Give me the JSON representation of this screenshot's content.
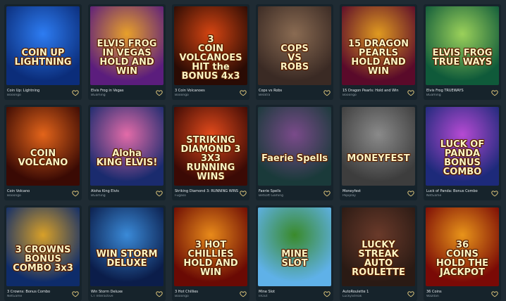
{
  "colors": {
    "background": "#1f2b33",
    "card": "#16232b",
    "heart": "#d9c27a"
  },
  "games": [
    {
      "title": "Coin Up: Lightning",
      "provider": "Booongo",
      "logo": "COIN UP\nLIGHTNING",
      "colors": [
        "#0b2d7a",
        "#2d7cf2"
      ],
      "icon": "heart-icon"
    },
    {
      "title": "Elvis Frog in Vegas",
      "provider": "BGaming",
      "logo": "ELVIS FROG\nIN VEGAS\nHOLD AND WIN",
      "colors": [
        "#5b1d7d",
        "#e8a02a"
      ],
      "icon": "heart-icon"
    },
    {
      "title": "3 Coin Volcanoes",
      "provider": "Booongo",
      "logo": "3\nCOIN\nVOLCANOES\nHIT the BONUS 4x3",
      "colors": [
        "#2a0b04",
        "#d64512"
      ],
      "icon": "heart-icon"
    },
    {
      "title": "Cops vs Robs",
      "provider": "Belatra",
      "logo": "COPS\nVS\nROBS",
      "colors": [
        "#3a2a24",
        "#8a6b52"
      ],
      "icon": "heart-icon"
    },
    {
      "title": "15 Dragon Pearls: Hold and Win",
      "provider": "Booongo",
      "logo": "15 DRAGON\nPEARLS\nHOLD AND WIN",
      "colors": [
        "#5a0a2a",
        "#e09a20"
      ],
      "icon": "heart-icon"
    },
    {
      "title": "Elvis Frog TRUEWAYS",
      "provider": "BGaming",
      "logo": "ELVIS FROG\nTRUE WAYS",
      "colors": [
        "#0f5a3a",
        "#9bd15a"
      ],
      "icon": "heart-icon"
    },
    {
      "title": "Coin Volcano",
      "provider": "Booongo",
      "logo": "COIN\nVOLCANO",
      "colors": [
        "#3a0a04",
        "#e3641a"
      ],
      "icon": "heart-icon"
    },
    {
      "title": "Aloha King Elvis",
      "provider": "BGaming",
      "logo": "Aloha\nKING ELVIS!",
      "colors": [
        "#1a2b6e",
        "#e36ba8"
      ],
      "icon": "heart-icon"
    },
    {
      "title": "Striking Diamond 3: RUNNING WINS",
      "provider": "Fugaso",
      "logo": "STRIKING\nDIAMOND 3\n3X3 RUNNING WINS",
      "colors": [
        "#3b0a05",
        "#e34a1b"
      ],
      "icon": "heart-icon"
    },
    {
      "title": "Faerie Spells",
      "provider": "Betsoft Gaming",
      "logo": "Faerie Spells",
      "colors": [
        "#1a3a3a",
        "#7a4a8a"
      ],
      "icon": "heart-icon"
    },
    {
      "title": "Moneyfest",
      "provider": "Popiplay",
      "logo": "MONEYFEST",
      "colors": [
        "#3d3d3d",
        "#8a8a8a"
      ],
      "icon": "heart-icon"
    },
    {
      "title": "Luck of Panda: Bonus Combo",
      "provider": "NetGame",
      "logo": "LUCK OF\nPANDA\nBONUS COMBO",
      "colors": [
        "#1d2a7a",
        "#b64ad3"
      ],
      "icon": "heart-icon"
    },
    {
      "title": "3 Crowns: Bonus Combo",
      "provider": "NetGame",
      "logo": "3 CROWNS\nBONUS COMBO 3x3",
      "colors": [
        "#0e2c6a",
        "#d8a028"
      ],
      "icon": "heart-icon"
    },
    {
      "title": "Win Storm Deluxe",
      "provider": "CT Interactive",
      "logo": "WIN STORM\nDELUXE",
      "colors": [
        "#0b1d4a",
        "#3a8ad8"
      ],
      "icon": "heart-icon"
    },
    {
      "title": "3 Hot Chillies",
      "provider": "Booongo",
      "logo": "3 HOT\nCHILLIES\nHOLD AND WIN",
      "colors": [
        "#6a0a04",
        "#e88a1a"
      ],
      "icon": "heart-icon"
    },
    {
      "title": "Mine Slot",
      "provider": "InOut",
      "logo": "MINE\nSLOT",
      "colors": [
        "#5fb1e8",
        "#3a8a2a"
      ],
      "icon": "heart-icon"
    },
    {
      "title": "AutoRoulette 1",
      "provider": "LuckyStreak",
      "logo": "LUCKY STREAK\nAUTO\nROULETTE",
      "colors": [
        "#2a1a14",
        "#6a3a2a"
      ],
      "icon": "heart-icon"
    },
    {
      "title": "36 Coins",
      "provider": "Wazdan",
      "logo": "36\nCOINS\nHOLD THE JACKPOT",
      "colors": [
        "#7a0a06",
        "#e8941a"
      ],
      "icon": "heart-icon"
    }
  ]
}
